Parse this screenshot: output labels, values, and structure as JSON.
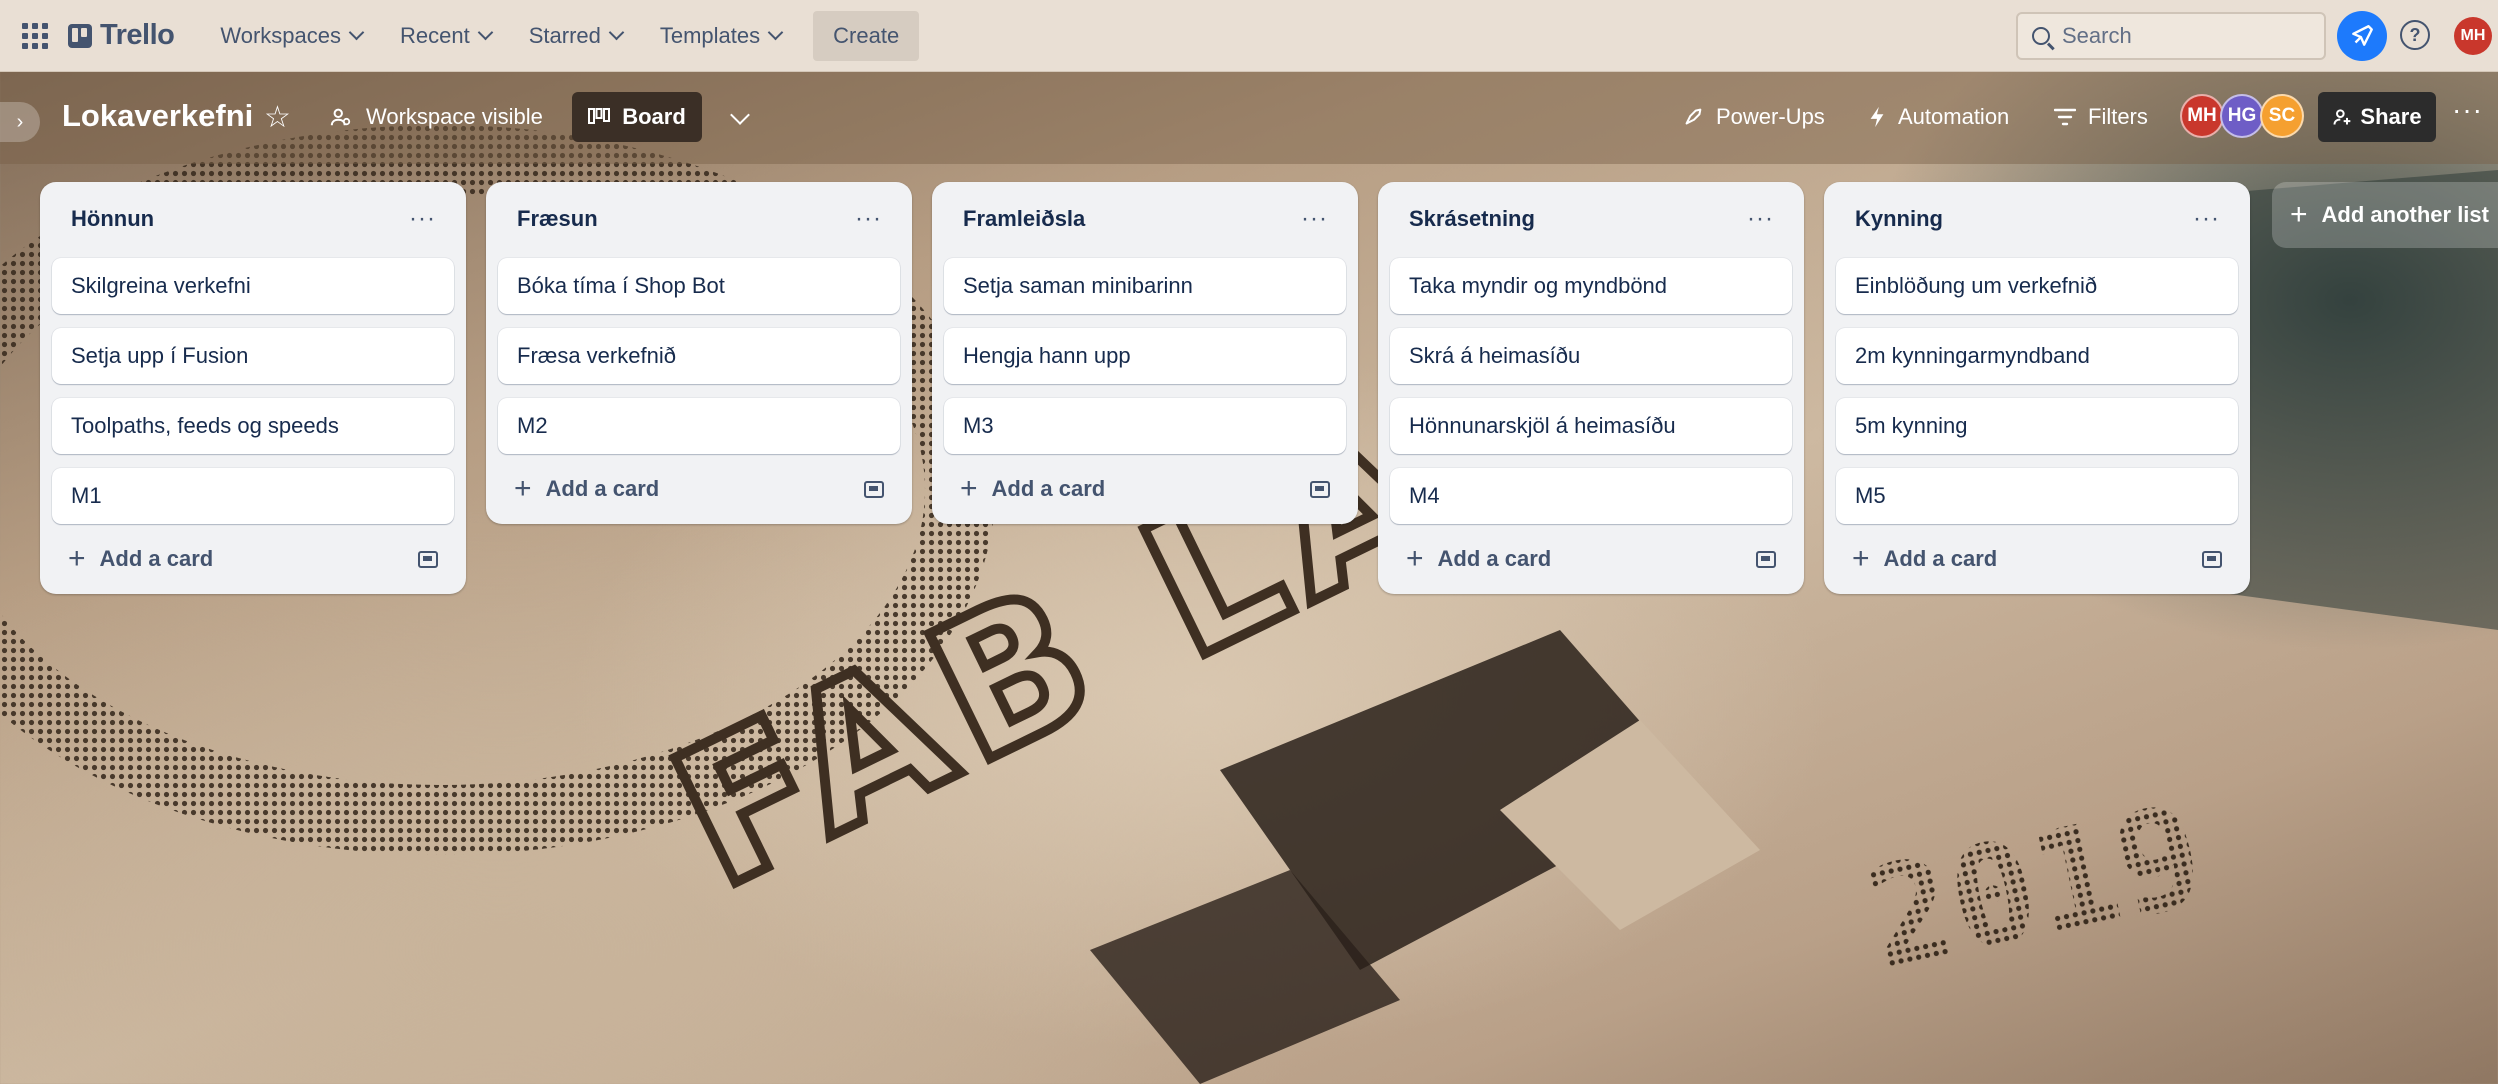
{
  "topnav": {
    "brand": "Trello",
    "menus": [
      "Workspaces",
      "Recent",
      "Starred",
      "Templates"
    ],
    "create_label": "Create",
    "search_placeholder": "Search",
    "user_initials": "MH",
    "colors": {
      "bar": "#e9dfd4",
      "notification": "#1d7afc",
      "user_avatar": "#c9372c"
    }
  },
  "board": {
    "title": "Lokaverkefni",
    "visibility": "Workspace visible",
    "view_label": "Board",
    "actions": {
      "powerups": "Power-Ups",
      "automation": "Automation",
      "filters": "Filters",
      "share": "Share"
    },
    "members": [
      {
        "initials": "MH",
        "color": "#c9372c"
      },
      {
        "initials": "HG",
        "color": "#6e5dc6"
      },
      {
        "initials": "SC",
        "color": "#f5a030"
      }
    ]
  },
  "lists": [
    {
      "title": "Hönnun",
      "cards": [
        "Skilgreina verkefni",
        "Setja upp í Fusion",
        "Toolpaths, feeds og speeds",
        "M1"
      ]
    },
    {
      "title": "Fræsun",
      "cards": [
        "Bóka tíma í Shop Bot",
        "Fræsa verkefnið",
        "M2"
      ]
    },
    {
      "title": "Framleiðsla",
      "cards": [
        "Setja saman minibarinn",
        "Hengja hann upp",
        "M3"
      ]
    },
    {
      "title": "Skrásetning",
      "cards": [
        "Taka myndir og myndbönd",
        "Skrá á heimasíðu",
        "Hönnunarskjöl á heimasíðu",
        "M4"
      ]
    },
    {
      "title": "Kynning",
      "cards": [
        "Einblöðung um verkefnið",
        "2m kynningarmyndband",
        "5m kynning",
        "M5"
      ]
    }
  ],
  "add_card_label": "Add a card",
  "add_list_label": "Add another list",
  "background": {
    "engraved_text": "FAB LAB",
    "engraved_year": "2019"
  }
}
